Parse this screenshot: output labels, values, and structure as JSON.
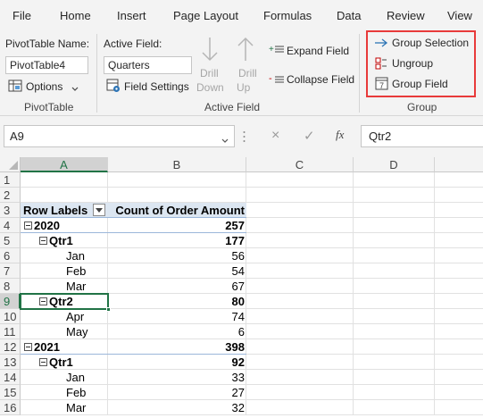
{
  "menu": {
    "items": [
      "File",
      "Home",
      "Insert",
      "Page Layout",
      "Formulas",
      "Data",
      "Review",
      "View"
    ]
  },
  "ribbon": {
    "pivottable_group": {
      "name_label": "PivotTable Name:",
      "name_value": "PivotTable4",
      "options_label": "Options",
      "group_label": "PivotTable"
    },
    "active_field_group": {
      "field_label": "Active Field:",
      "field_value": "Quarters",
      "field_settings_label": "Field Settings",
      "drill_down_line1": "Drill",
      "drill_down_line2": "Down",
      "drill_up_line1": "Drill",
      "drill_up_line2": "Up",
      "expand_label": "Expand Field",
      "collapse_label": "Collapse Field",
      "group_label": "Active Field"
    },
    "group_group": {
      "group_selection_label": "Group Selection",
      "ungroup_label": "Ungroup",
      "group_field_label": "Group Field",
      "group_label": "Group",
      "highlight_color": "#e83a3a"
    }
  },
  "formula_bar": {
    "name_box": "A9",
    "cancel_icon": "×",
    "enter_icon": "✓",
    "fx_icon": "fx",
    "formula": "Qtr2"
  },
  "grid": {
    "columns": [
      "A",
      "B",
      "C",
      "D"
    ],
    "selected_column": "A",
    "selected_row": "9",
    "row_numbers": [
      "1",
      "2",
      "3",
      "4",
      "5",
      "6",
      "7",
      "8",
      "9",
      "10",
      "11",
      "12",
      "13",
      "14",
      "15",
      "16"
    ],
    "header_labels": "Row Labels",
    "header_values": "Count of Order Amount",
    "rows": [
      {
        "label": "2020",
        "value": "257"
      },
      {
        "label": "Qtr1",
        "value": "177"
      },
      {
        "label": "Jan",
        "value": "56"
      },
      {
        "label": "Feb",
        "value": "54"
      },
      {
        "label": "Mar",
        "value": "67"
      },
      {
        "label": "Qtr2",
        "value": "80"
      },
      {
        "label": "Apr",
        "value": "74"
      },
      {
        "label": "May",
        "value": "6"
      },
      {
        "label": "2021",
        "value": "398"
      },
      {
        "label": "Qtr1",
        "value": "92"
      },
      {
        "label": "Jan",
        "value": "33"
      },
      {
        "label": "Feb",
        "value": "27"
      },
      {
        "label": "Mar",
        "value": "32"
      }
    ]
  },
  "colors": {
    "excel_green": "#217346",
    "pivot_header_bg": "#dce6f1",
    "pivot_line": "#9bb7da"
  }
}
